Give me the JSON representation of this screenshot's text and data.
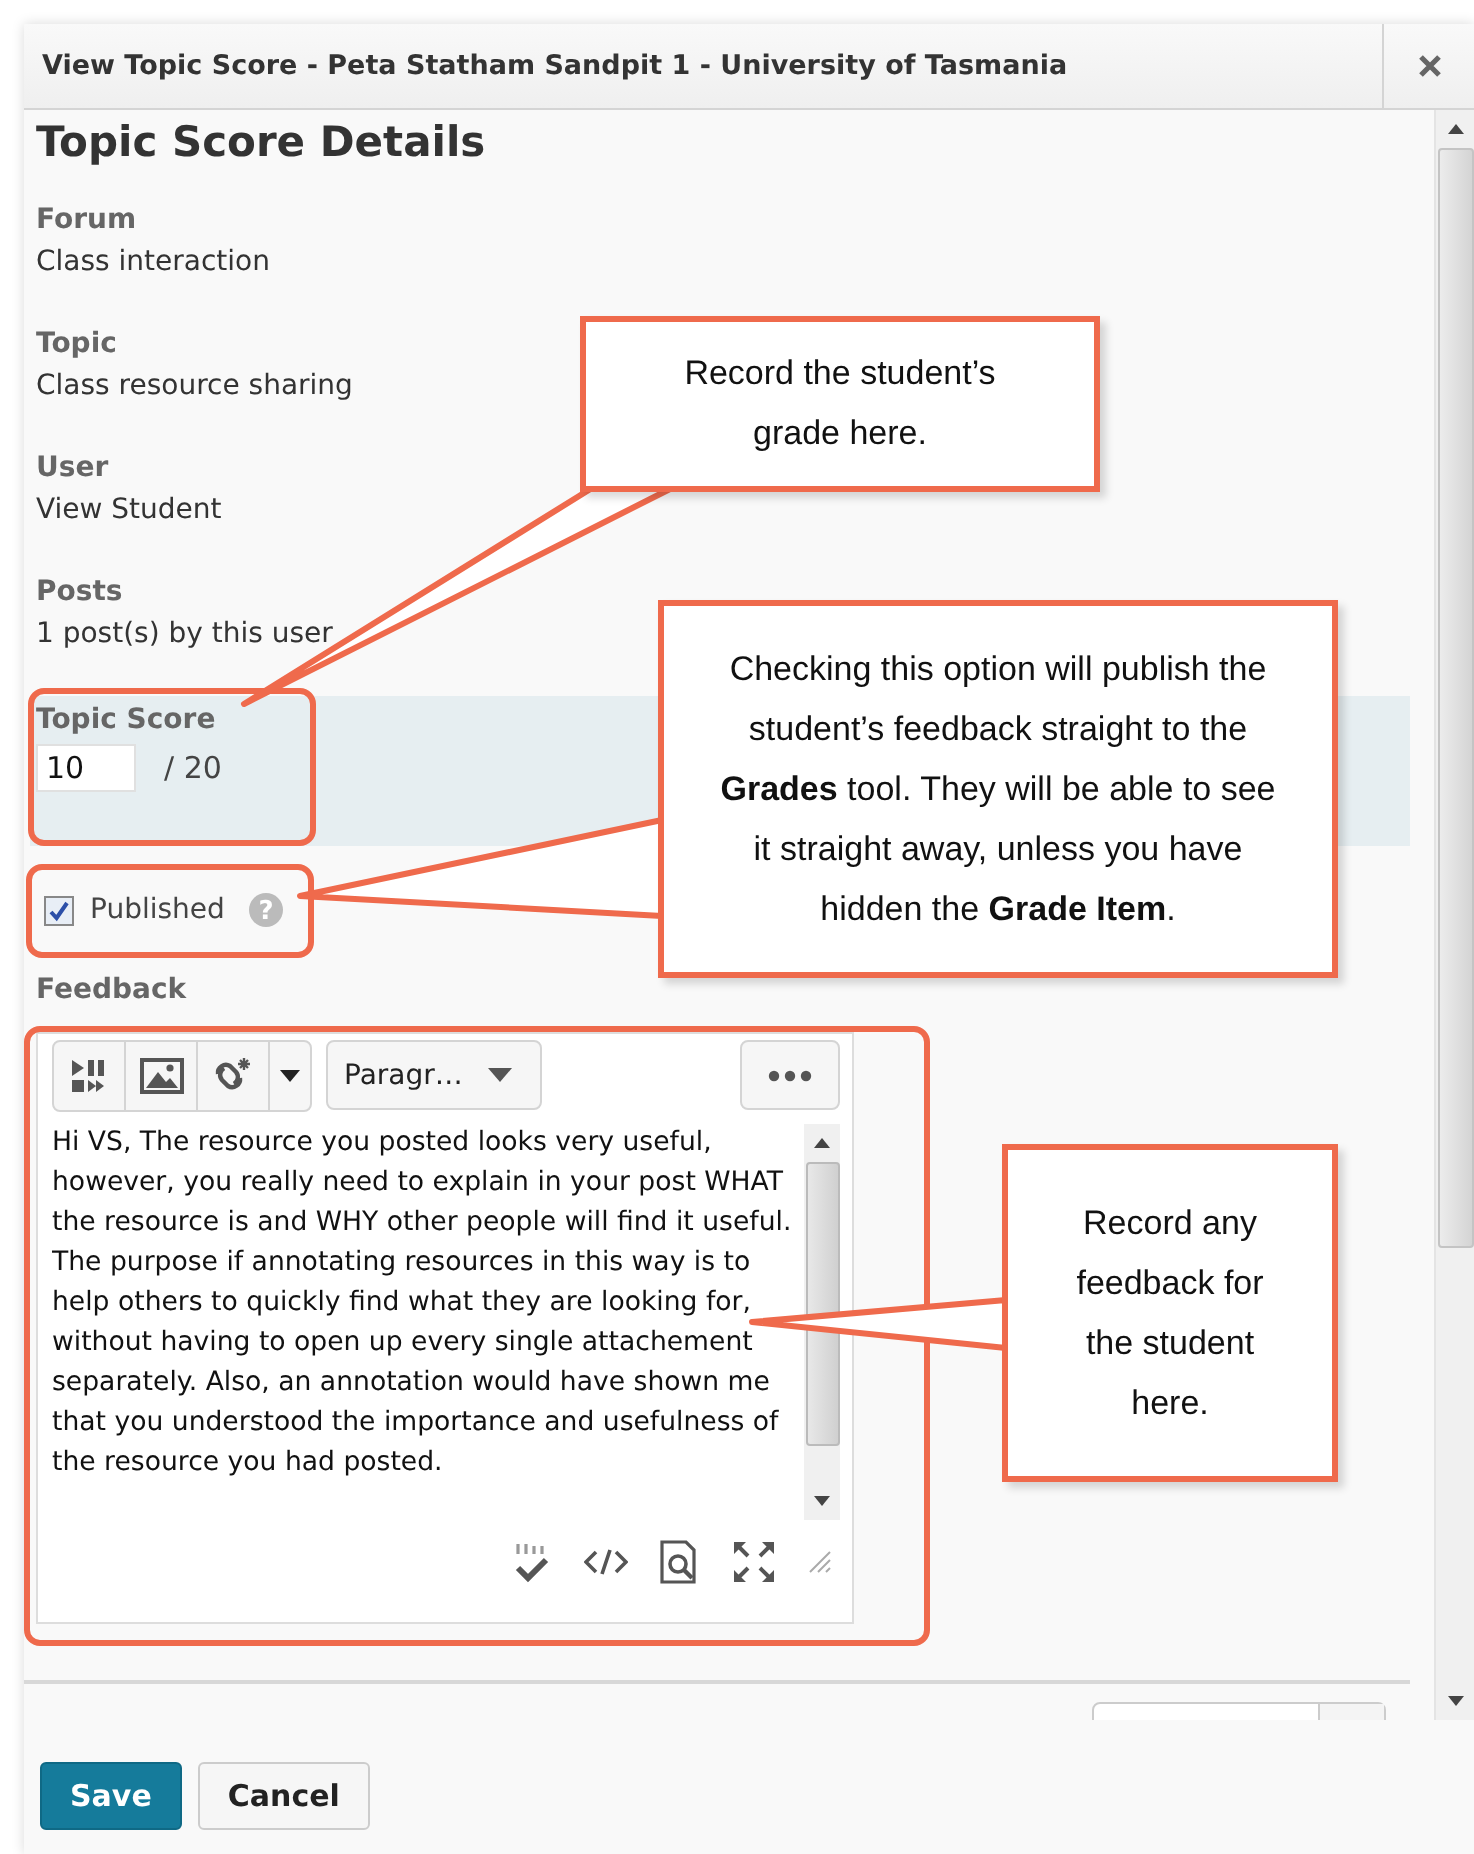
{
  "window": {
    "title": "View Topic Score - Peta Statham Sandpit 1 - University of Tasmania"
  },
  "heading": "Topic Score Details",
  "fields": [
    {
      "label": "Forum",
      "value": "Class interaction"
    },
    {
      "label": "Topic",
      "value": "Class resource sharing"
    },
    {
      "label": "User",
      "value": "View Student"
    },
    {
      "label": "Posts",
      "value": "1 post(s) by this user"
    }
  ],
  "topic_score": {
    "label": "Topic Score",
    "value": "10",
    "out_of": "/ 20"
  },
  "published": {
    "label": "Published",
    "checked": true,
    "help_symbol": "?"
  },
  "feedback": {
    "label": "Feedback",
    "format": "Paragr…",
    "text": "Hi VS, The resource you posted looks very useful, however, you really need to explain in your post WHAT the resource is and WHY other people will find it useful. The purpose if annotating resources in this way is to help others to quickly find what they are looking for, without having to open up every single attachement separately. Also, an annotation would have shown me that you understood the importance and usefulness of the resource you had posted."
  },
  "buttons": [
    {
      "label": "Save",
      "kind": "primary"
    },
    {
      "label": "Cancel",
      "kind": "secondary"
    }
  ],
  "callouts": [
    {
      "text": "Record the student’s grade here."
    },
    {
      "text": "Checking this option will publish the student’s feedback straight to the **Grades** tool. They will be able to see it straight away, unless you have hidden the **Grade Item**."
    },
    {
      "text": "Record any feedback for the student here."
    }
  ]
}
